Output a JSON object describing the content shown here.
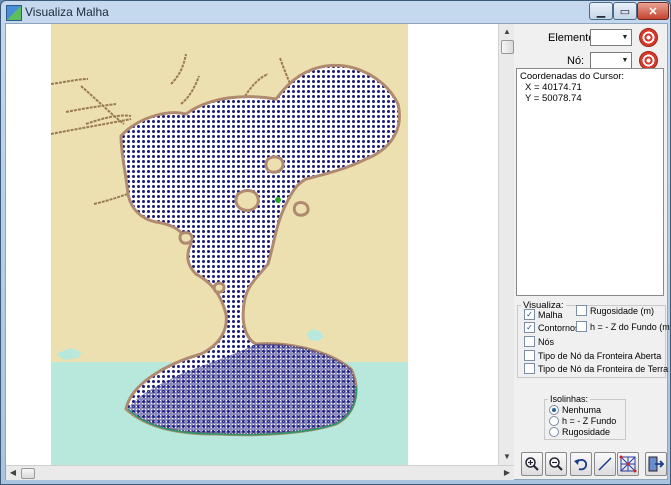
{
  "window": {
    "title": "Visualiza Malha",
    "controls": [
      "minimize-icon",
      "maximize-icon",
      "close-icon"
    ]
  },
  "map": {
    "land_color": "#ede0b0",
    "water_color": "#b8e8dc",
    "mesh_color": "#1a1a7a",
    "boundary_color": "#b08a70"
  },
  "panel": {
    "elemento_label": "Elemento:",
    "elemento_value": "",
    "no_label": "Nó:",
    "no_value": "",
    "coords": {
      "title": "Coordenadas do Cursor:",
      "x": "X = 40174.71",
      "y": "Y = 50078.74"
    },
    "visualiza": {
      "legend": "Visualiza:",
      "malha": "Malha",
      "rugosidade": "Rugosidade (m)",
      "contornos": "Contornos",
      "h_z": "h = - Z do Fundo (m)",
      "nos": "Nós",
      "tipo_aberta": "Tipo de Nó da Fronteira Aberta",
      "tipo_terra": "Tipo de Nó da Fronteira de Terra",
      "checked": [
        "malha",
        "contornos"
      ]
    },
    "isolinhas": {
      "legend": "Isolinhas:",
      "nenhuma": "Nenhuma",
      "hz": "h = - Z Fundo",
      "rugosidade": "Rugosidade",
      "selected": "nenhuma"
    },
    "toolbar": [
      "zoom-in-icon",
      "zoom-out-icon",
      "undo-icon",
      "draw-line-icon",
      "grid-select-icon",
      "exit-icon"
    ]
  }
}
